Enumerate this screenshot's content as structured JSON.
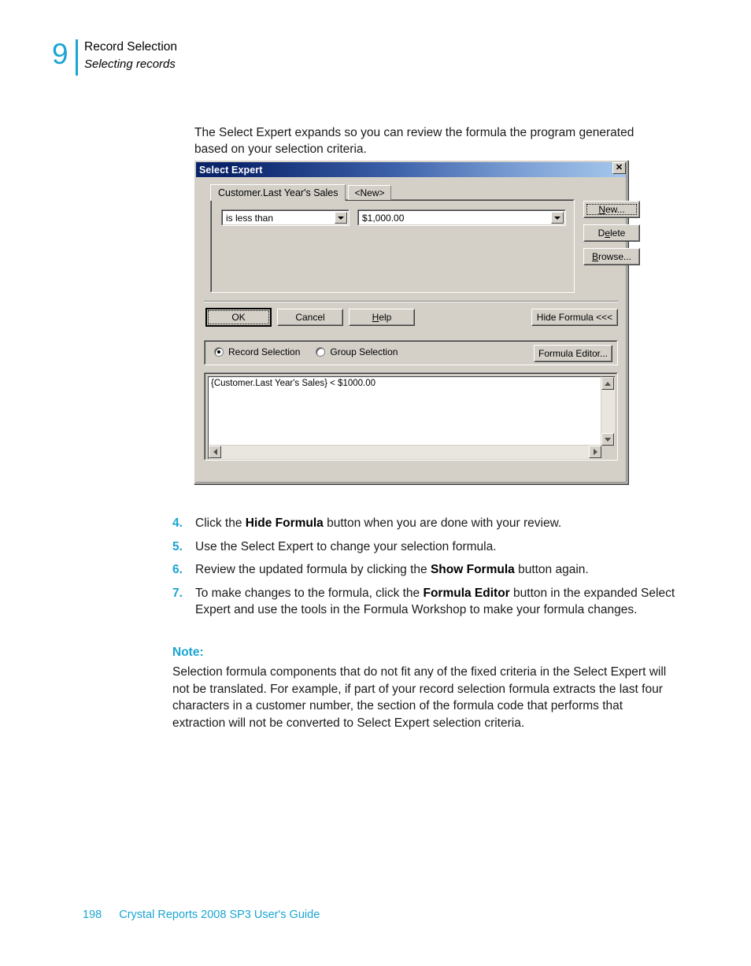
{
  "header": {
    "chapter_number": "9",
    "title": "Record Selection",
    "subtitle": "Selecting records"
  },
  "intro": "The Select Expert expands so you can review the formula the program generated based on your selection criteria.",
  "dialog": {
    "title": "Select Expert",
    "close_label": "✕",
    "tabs": [
      {
        "label": "Customer.Last Year's Sales",
        "active": true
      },
      {
        "label": "<New>",
        "active": false
      }
    ],
    "operator_combo": {
      "value": "is less than",
      "placeholder": "is less than"
    },
    "value_combo": {
      "value": "$1,000.00",
      "placeholder": "$1,000.00"
    },
    "side_buttons": [
      {
        "pre": "",
        "mnemonic": "N",
        "post": "ew..."
      },
      {
        "pre": "D",
        "mnemonic": "e",
        "post": "lete"
      },
      {
        "pre": "",
        "mnemonic": "B",
        "post": "rowse..."
      }
    ],
    "action_buttons": {
      "ok": "OK",
      "cancel": "Cancel",
      "help_pre": "",
      "help_mnemonic": "H",
      "help_post": "elp",
      "hide_formula": "Hide Formula <<<"
    },
    "selection_mode": {
      "record_label": "Record Selection",
      "group_label": "Group Selection",
      "selected": "record",
      "formula_editor_label": "Formula Editor..."
    },
    "formula_text": "{Customer.Last Year's Sales} < $1000.00"
  },
  "steps": [
    {
      "number": "4.",
      "segments": [
        {
          "text": "Click the ",
          "bold": false
        },
        {
          "text": "Hide Formula",
          "bold": true
        },
        {
          "text": " button when you are done with your review.",
          "bold": false
        }
      ]
    },
    {
      "number": "5.",
      "segments": [
        {
          "text": "Use the Select Expert to change your selection formula.",
          "bold": false
        }
      ]
    },
    {
      "number": "6.",
      "segments": [
        {
          "text": "Review the updated formula by clicking the ",
          "bold": false
        },
        {
          "text": "Show Formula",
          "bold": true
        },
        {
          "text": " button again.",
          "bold": false
        }
      ]
    },
    {
      "number": "7.",
      "segments": [
        {
          "text": "To make changes to the formula, click the ",
          "bold": false
        },
        {
          "text": "Formula Editor",
          "bold": true
        },
        {
          "text": " button in the expanded Select Expert and use the tools in the Formula Workshop to make your formula changes.",
          "bold": false
        }
      ]
    }
  ],
  "note": {
    "heading": "Note:",
    "body": "Selection formula components that do not fit any of the fixed criteria in the Select Expert will not be translated. For example, if part of your record selection formula extracts the last four characters in a customer number, the section of the formula code that performs that extraction will not be converted to Select Expert selection criteria."
  },
  "footer": {
    "page_number": "198",
    "guide_title": "Crystal Reports 2008 SP3 User's Guide"
  },
  "colors": {
    "accent": "#1ba5d2",
    "dialog_face": "#d4d0c8",
    "titlebar_dark": "#0a246a",
    "titlebar_light": "#a6c8ec"
  }
}
